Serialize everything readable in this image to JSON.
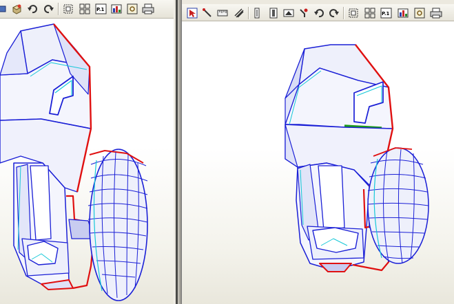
{
  "left_pane": {
    "toolbar": {
      "icons": [
        "move-icon",
        "cube-icon",
        "undo-icon",
        "redo-icon",
        "select-all-icon",
        "layout-icon",
        "page-icon",
        "texture-icon",
        "settings-icon",
        "print-icon"
      ],
      "page_label": "P.1"
    }
  },
  "right_pane": {
    "toolbar": {
      "icons": [
        "pointer-icon",
        "pen-icon",
        "ruler-icon",
        "fold-icon",
        "edge-icon",
        "join-icon",
        "flap-icon",
        "rotate-icon",
        "undo-icon",
        "redo-icon",
        "select-all-icon",
        "layout-icon",
        "page-icon",
        "texture-icon",
        "settings-icon",
        "print-icon"
      ],
      "page_label": "P.1"
    }
  },
  "colors": {
    "mesh_fill": "#eef0fb",
    "mesh_shade": "#c8ccf0",
    "mesh_edge": "#1a1fd6",
    "cut_edge": "#e01010",
    "fold_edge": "#14c8d8",
    "selected_edge": "#1a9a1a"
  }
}
